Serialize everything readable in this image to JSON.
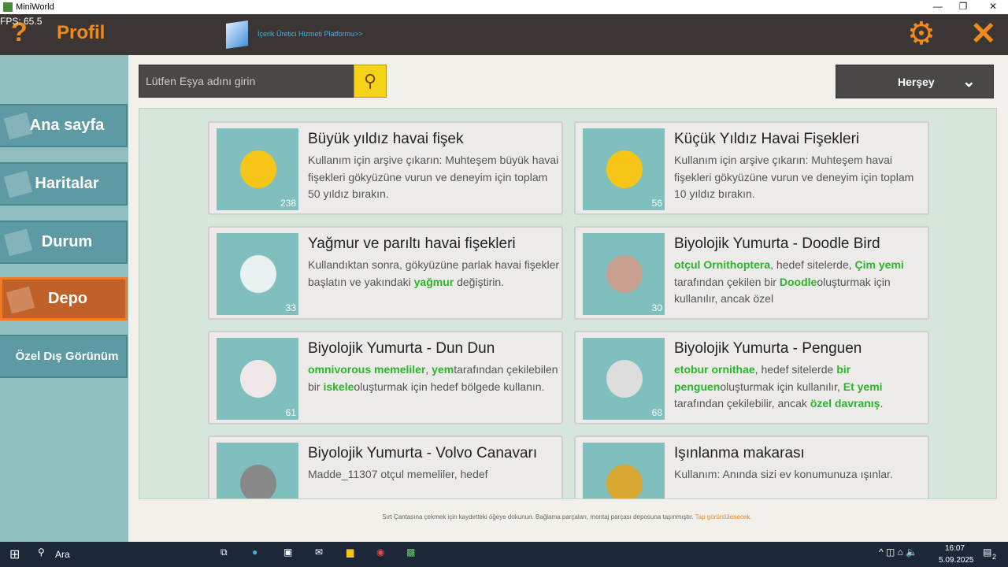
{
  "window": {
    "title": "MiniWorld",
    "fps": "FPS: 65.5"
  },
  "header": {
    "help": "?",
    "title": "Profil",
    "platform_link": "İçerik Üretici Hizmeti Platformu>>",
    "settings": "⚙",
    "close": "✕"
  },
  "sidebar": {
    "items": [
      {
        "label": "Ana sayfa"
      },
      {
        "label": "Haritalar"
      },
      {
        "label": "Durum"
      },
      {
        "label": "Depo",
        "active": true
      },
      {
        "label": "Özel Dış Görünüm"
      }
    ]
  },
  "search": {
    "placeholder": "Lütfen Eşya adını girin"
  },
  "filter": {
    "selected": "Herşey"
  },
  "items": [
    {
      "name": "Büyük yıldız havai fişek",
      "count": "238",
      "desc": [
        {
          "t": "Kullanım için arşive çıkarın: Muhteşem büyük havai fişekleri gökyüzüne vurun ve deneyim için toplam 50 yıldız bırakın."
        }
      ]
    },
    {
      "name": "Küçük Yıldız Havai Fişekleri",
      "count": "56",
      "desc": [
        {
          "t": "Kullanım için arşive çıkarın: Muhteşem havai fişekleri gökyüzüne vurun ve deneyim için toplam 10 yıldız bırakın."
        }
      ]
    },
    {
      "name": "Yağmur ve parıltı havai fişekleri",
      "count": "33",
      "desc": [
        {
          "t": "Kullandıktan sonra, gökyüzüne parlak havai fişekler başlatın ve yakındaki "
        },
        {
          "t": "yağmur",
          "g": true
        },
        {
          "t": " değiştirin."
        }
      ]
    },
    {
      "name": "Biyolojik Yumurta - Doodle Bird",
      "count": "30",
      "desc": [
        {
          "t": " otçul Ornithoptera",
          "g": true
        },
        {
          "t": ", hedef sitelerde, "
        },
        {
          "t": "Çim yemi",
          "g": true
        },
        {
          "t": " tarafından çekilen bir "
        },
        {
          "t": "Doodle",
          "g": true
        },
        {
          "t": "oluşturmak için kullanılır, ancak özel"
        }
      ]
    },
    {
      "name": "Biyolojik Yumurta - Dun Dun",
      "count": "61",
      "desc": [
        {
          "t": " omnivorous memeliler",
          "g": true
        },
        {
          "t": ", "
        },
        {
          "t": "yem",
          "g": true
        },
        {
          "t": "tarafından çekilebilen bir "
        },
        {
          "t": "iskele",
          "g": true
        },
        {
          "t": "oluşturmak için hedef bölgede kullanın."
        }
      ]
    },
    {
      "name": "Biyolojik Yumurta - Penguen",
      "count": "68",
      "desc": [
        {
          "t": " etobur ornithae",
          "g": true
        },
        {
          "t": ", hedef sitelerde "
        },
        {
          "t": "bir penguen",
          "g": true
        },
        {
          "t": "oluşturmak için kullanılır, "
        },
        {
          "t": "Et yemi",
          "g": true
        },
        {
          "t": " tarafından çekilebilir, ancak "
        },
        {
          "t": "özel davranış",
          "g": true
        },
        {
          "t": "."
        }
      ]
    },
    {
      "name": "Biyolojik Yumurta - Volvo Canavarı",
      "count": "",
      "desc": [
        {
          "t": "Madde_11307 otçul memeliler, hedef"
        }
      ]
    },
    {
      "name": "Işınlanma makarası",
      "count": "",
      "desc": [
        {
          "t": "Kullanım: Anında sizi ev konumunuza ışınlar."
        }
      ]
    }
  ],
  "footer": {
    "text": "Sırt Çantasına çekmek için kaydetteki öğeye dokunun. Bağlama parçaları, montaj parçası deposuna taşınmıştır. ",
    "link": "Tap görüntülenecek."
  },
  "taskbar": {
    "search": "Ara",
    "time": "16:07",
    "date": "5.09.2025",
    "notifications": "2"
  }
}
